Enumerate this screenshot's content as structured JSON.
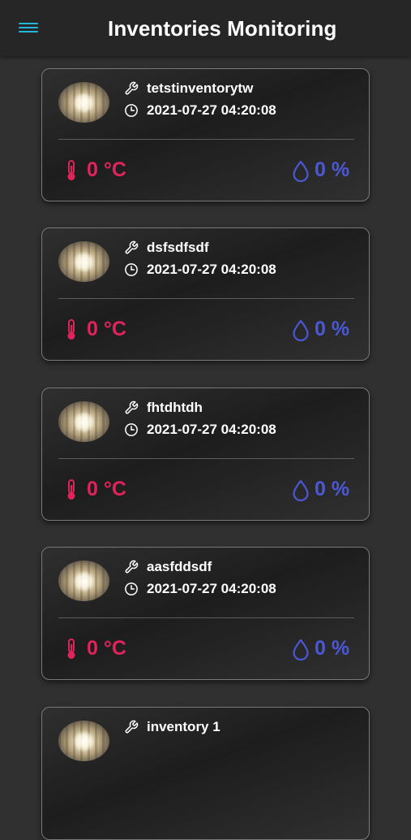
{
  "appbar": {
    "title": "Inventories Monitoring",
    "menu_icon": "hamburger-menu-icon"
  },
  "colors": {
    "appbar_bg": "#262626",
    "page_bg": "#303030",
    "menu_icon": "#25b6dd",
    "temperature": "#e0245b",
    "humidity": "#4b58d6"
  },
  "inventories": [
    {
      "name": "tetstinventorytw",
      "timestamp": "2021-07-27 04:20:08",
      "temperature": "0 °C",
      "humidity": "0 %"
    },
    {
      "name": "dsfsdfsdf",
      "timestamp": "2021-07-27 04:20:08",
      "temperature": "0 °C",
      "humidity": "0 %"
    },
    {
      "name": "fhtdhtdh",
      "timestamp": "2021-07-27 04:20:08",
      "temperature": "0 °C",
      "humidity": "0 %"
    },
    {
      "name": "aasfddsdf",
      "timestamp": "2021-07-27 04:20:08",
      "temperature": "0 °C",
      "humidity": "0 %"
    },
    {
      "name": "inventory 1",
      "timestamp": "",
      "temperature": "",
      "humidity": ""
    }
  ]
}
